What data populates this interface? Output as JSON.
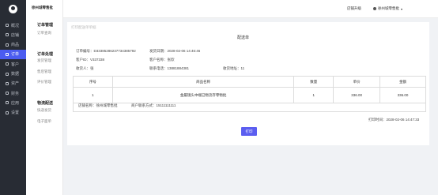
{
  "sidebar": {
    "items": [
      {
        "label": "概况",
        "icon": "home-icon",
        "active": false
      },
      {
        "label": "店铺",
        "icon": "shop-icon",
        "active": false
      },
      {
        "label": "商品",
        "icon": "goods-icon",
        "active": false
      },
      {
        "label": "订单",
        "icon": "order-icon",
        "active": true
      },
      {
        "label": "客户",
        "icon": "customer-icon",
        "active": false
      },
      {
        "label": "数据",
        "icon": "data-icon",
        "active": false
      },
      {
        "label": "资产",
        "icon": "asset-icon",
        "active": false
      },
      {
        "label": "财务",
        "icon": "finance-icon",
        "active": false
      },
      {
        "label": "应用",
        "icon": "apps-icon",
        "active": false
      },
      {
        "label": "设置",
        "icon": "settings-icon",
        "active": false
      }
    ],
    "accent": "#4b5cf0",
    "background": "#282c34"
  },
  "subnav": {
    "shop_name": "徐州城零售批",
    "groups": [
      {
        "title": "订单管理",
        "items": [
          "订单查询"
        ]
      },
      {
        "title": "订单处理",
        "items": [
          "发货管理",
          "售后管理",
          "评价管理"
        ]
      },
      {
        "title": "物流配送",
        "items": [
          "快递发货",
          "电子面单"
        ]
      }
    ]
  },
  "topbar": {
    "upgrade": "店铺升级",
    "user": "徐州城零售批"
  },
  "breadcrumb": "打印配送单单据",
  "document": {
    "title": "配送单",
    "order_no": "订单编号：D33385286237734385792",
    "ship_date": "发货日期：2028-02-06 14:46:46",
    "customer_id": "客户ID：V337338",
    "customer_name": "客户名称：张欣",
    "receiver": "收货人：张",
    "phone": "联系电话：13881884381",
    "address": "收货地址：11",
    "table": {
      "headers": [
        "序号",
        "商品名称",
        "数量",
        "单价",
        "金额"
      ],
      "rows": [
        [
          "1",
          "金屬镜头中端已物流存零物批",
          "1",
          "336.00",
          "336.00"
        ]
      ]
    },
    "shop": "店铺名称：徐州城零售批",
    "contact": "商户联系方式：15111111111",
    "print_time": "打印时间：2028-02-06 14:47:33"
  },
  "actions": {
    "print": "打印"
  }
}
